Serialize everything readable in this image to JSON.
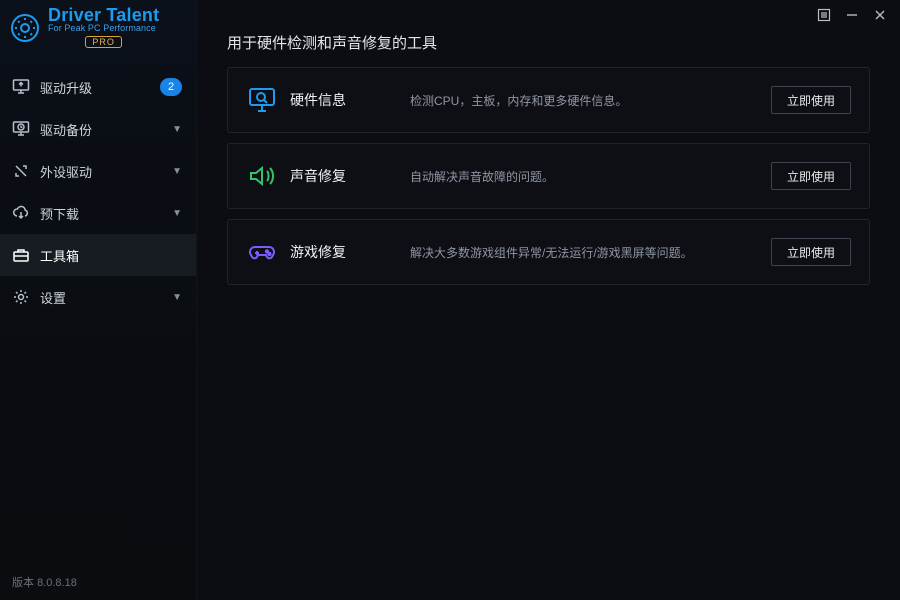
{
  "logo": {
    "name": "Driver Talent",
    "tagline": "For Peak PC Performance",
    "pro": "PRO"
  },
  "sidebar": {
    "items": [
      {
        "label": "驱动升级",
        "badge": "2"
      },
      {
        "label": "驱动备份"
      },
      {
        "label": "外设驱动"
      },
      {
        "label": "预下载"
      },
      {
        "label": "工具箱"
      },
      {
        "label": "设置"
      }
    ]
  },
  "footer": {
    "version_label": "版本",
    "version": "8.0.8.18"
  },
  "page": {
    "title": "用于硬件检测和声音修复的工具"
  },
  "tools": [
    {
      "icon": "monitor-search",
      "name": "硬件信息",
      "desc": "检测CPU，主板，内存和更多硬件信息。",
      "action": "立即使用",
      "color": "#1d9bf0"
    },
    {
      "icon": "sound-fix",
      "name": "声音修复",
      "desc": "自动解决声音故障的问题。",
      "action": "立即使用",
      "color": "#33c26a"
    },
    {
      "icon": "game-fix",
      "name": "游戏修复",
      "desc": "解决大多数游戏组件异常/无法运行/游戏黑屏等问题。",
      "action": "立即使用",
      "color": "#7a5cff"
    }
  ]
}
